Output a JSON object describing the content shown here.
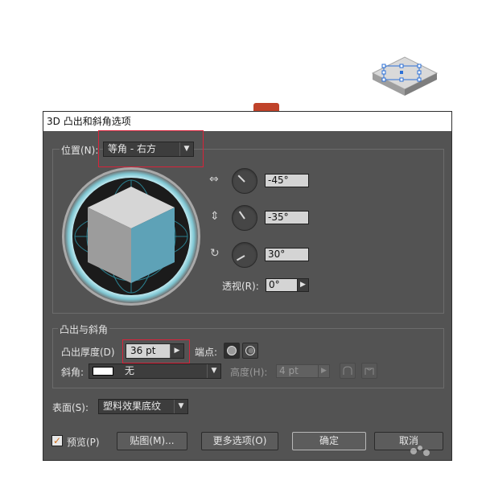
{
  "dialog": {
    "title": "3D 凸出和斜角选项",
    "position": {
      "label": "位置(N):",
      "preset_value": "等角 - 右方",
      "x_angle": "-45°",
      "y_angle": "-35°",
      "z_angle": "30°",
      "perspective_label": "透视(R):",
      "perspective_value": "0°"
    },
    "extrude": {
      "section_title": "凸出与斜角",
      "depth_label": "凸出厚度(D)",
      "depth_value": "36 pt",
      "cap_label": "端点:",
      "bevel_label": "斜角:",
      "bevel_value": "无",
      "height_label": "高度(H):",
      "height_value": "4 pt"
    },
    "surface": {
      "label": "表面(S):",
      "value": "塑料效果底纹"
    },
    "footer": {
      "preview_label": "预览(P)",
      "preview_checked": true,
      "map_button": "贴图(M)...",
      "more_options_button": "更多选项(O)",
      "ok_button": "确定",
      "cancel_button": "取消"
    }
  },
  "colors": {
    "dialog_bg": "#535353",
    "highlight": "#d8233a",
    "cube_front": "#5ea2b7",
    "cube_left": "#9c9c9c",
    "cube_top": "#d6d6d6"
  }
}
